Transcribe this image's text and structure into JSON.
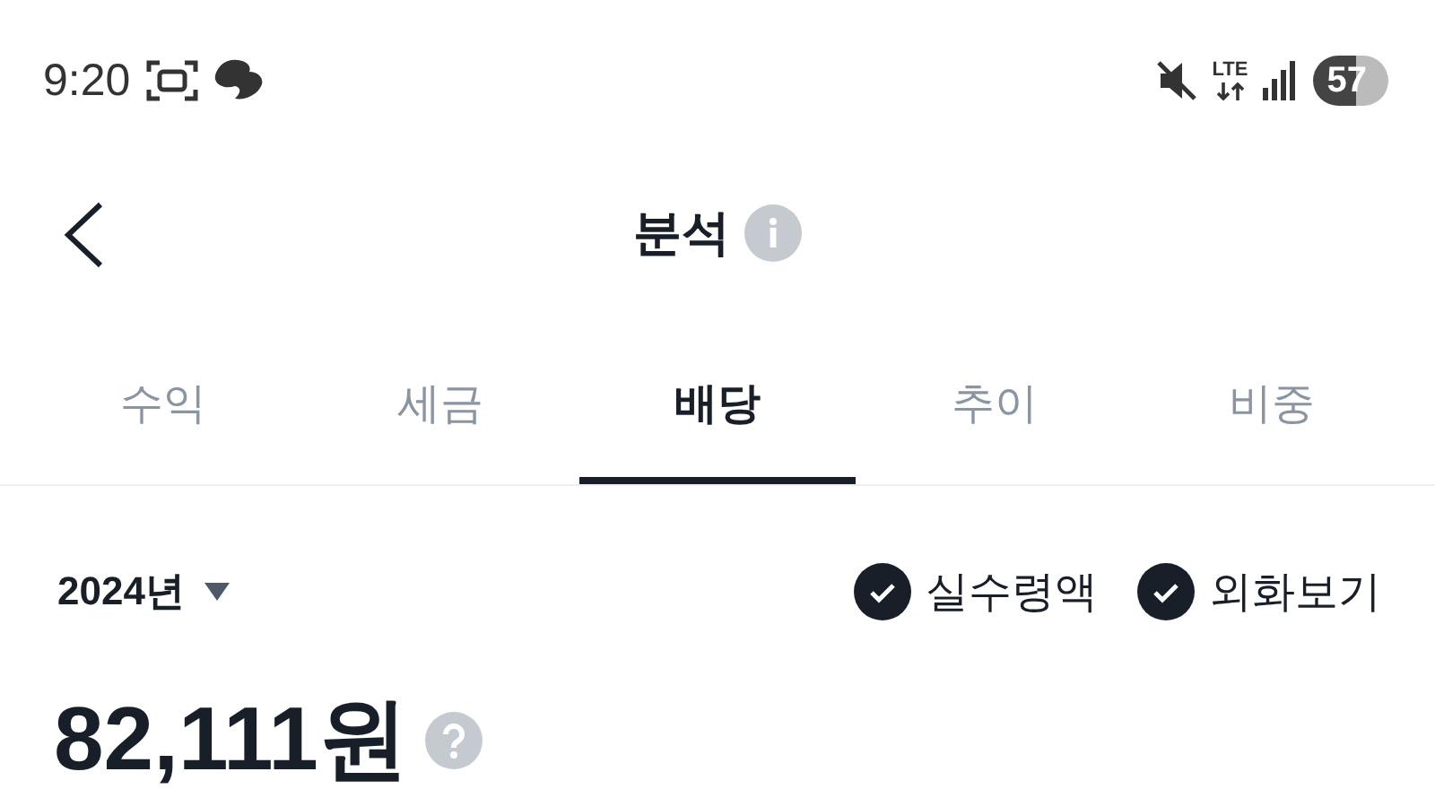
{
  "status_bar": {
    "time": "9:20",
    "network": "LTE",
    "battery": "57"
  },
  "header": {
    "title": "분석"
  },
  "tabs": [
    {
      "label": "수익",
      "selected": false
    },
    {
      "label": "세금",
      "selected": false
    },
    {
      "label": "배당",
      "selected": true
    },
    {
      "label": "추이",
      "selected": false
    },
    {
      "label": "비중",
      "selected": false
    }
  ],
  "filter": {
    "year": "2024년",
    "options": [
      {
        "label": "실수령액",
        "checked": true
      },
      {
        "label": "외화보기",
        "checked": true
      }
    ]
  },
  "total": {
    "amount": "82,111원"
  }
}
